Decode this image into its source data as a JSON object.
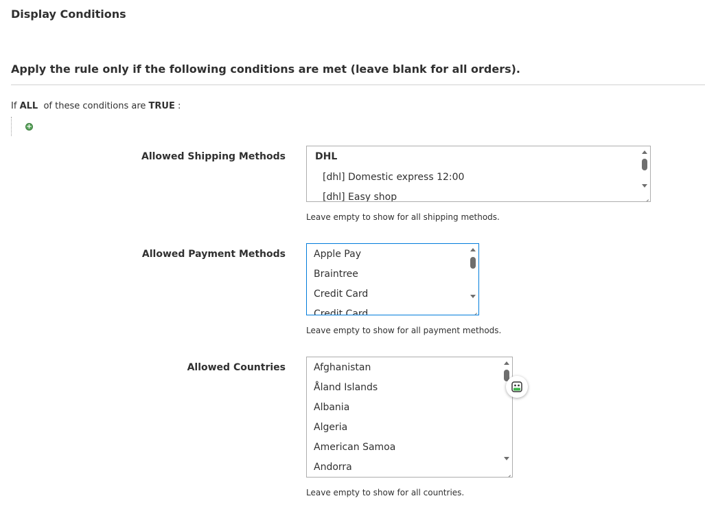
{
  "section": {
    "title": "Display Conditions"
  },
  "conditions": {
    "fieldset_title": "Apply the rule only if the following conditions are met (leave blank for all orders).",
    "prefix": "If",
    "aggregator": "ALL",
    "middle": "of these conditions are",
    "value": "TRUE",
    "suffix": ":"
  },
  "shipping": {
    "label": "Allowed Shipping Methods",
    "group": "DHL",
    "options": [
      "[dhl] Domestic express 12:00",
      "[dhl] Easy shop"
    ],
    "note": "Leave empty to show for all shipping methods."
  },
  "payment": {
    "label": "Allowed Payment Methods",
    "options": [
      "Apple Pay",
      "Braintree",
      "Credit Card",
      "Credit Card"
    ],
    "note": "Leave empty to show for all payment methods."
  },
  "countries": {
    "label": "Allowed Countries",
    "options": [
      "Afghanistan",
      "Åland Islands",
      "Albania",
      "Algeria",
      "American Samoa",
      "Andorra"
    ],
    "note": "Leave empty to show for all countries."
  },
  "colors": {
    "accent": "#007bdb",
    "add_icon": "#59a35b",
    "widget_green": "#3cb54a"
  }
}
